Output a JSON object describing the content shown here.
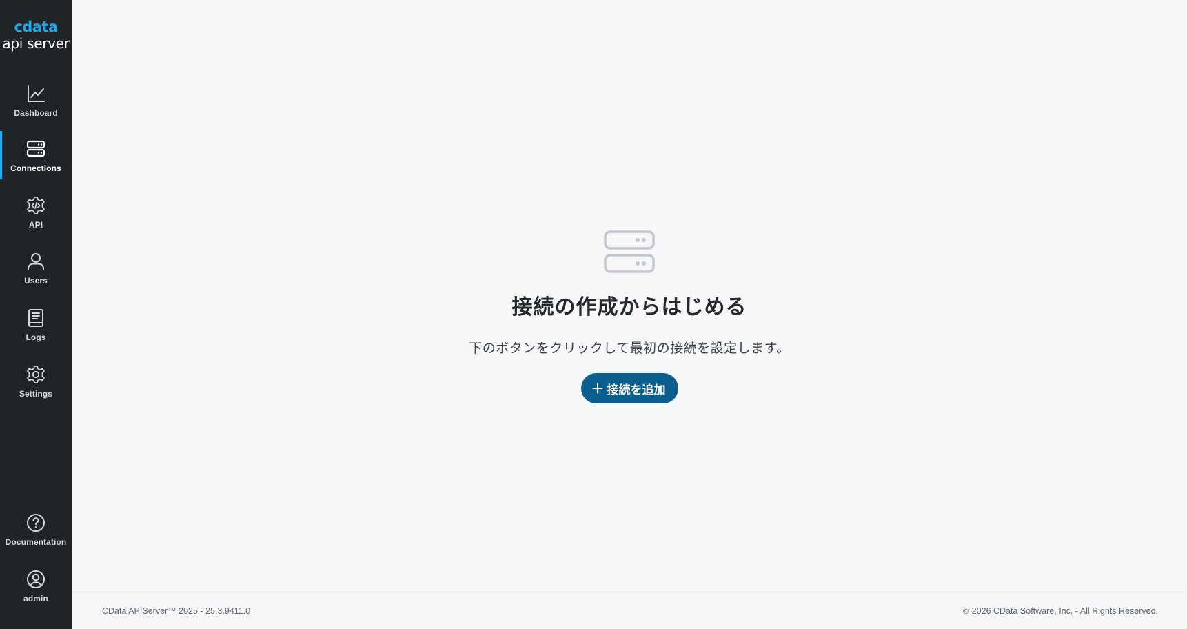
{
  "sidebar": {
    "logo": {
      "brand": "cdata",
      "product": "api server"
    },
    "items": [
      {
        "label": "Dashboard",
        "icon": "chart-line-icon"
      },
      {
        "label": "Connections",
        "icon": "server-icon",
        "active": true
      },
      {
        "label": "API",
        "icon": "gear-code-icon"
      },
      {
        "label": "Users",
        "icon": "user-icon"
      },
      {
        "label": "Logs",
        "icon": "book-icon"
      },
      {
        "label": "Settings",
        "icon": "gear-icon"
      }
    ],
    "bottom_items": [
      {
        "label": "Documentation",
        "icon": "help-circle-icon"
      },
      {
        "label": "admin",
        "icon": "user-circle-icon"
      }
    ]
  },
  "empty_state": {
    "icon": "server-icon",
    "title": "接続の作成からはじめる",
    "description": "下のボタンをクリックして最初の接続を設定します。",
    "button_label": "接続を追加"
  },
  "footer": {
    "version": "CData APIServer™ 2025 - 25.3.9411.0",
    "copyright": "© 2026 CData Software, Inc. - All Rights Reserved."
  },
  "colors": {
    "sidebar_bg": "#1f2429",
    "accent": "#1ea7e8",
    "button_bg": "#0b5f8e",
    "page_bg": "#f5f7f9"
  }
}
